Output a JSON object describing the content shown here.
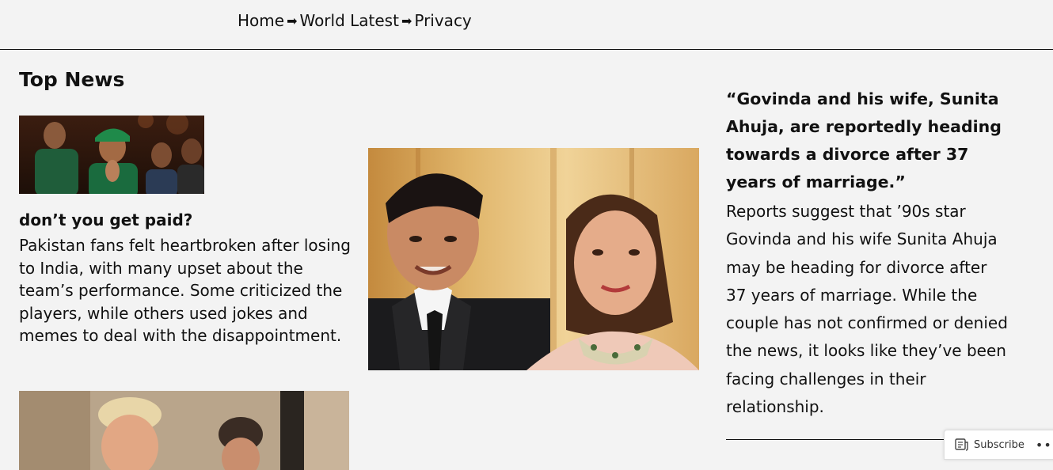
{
  "nav": {
    "items": [
      {
        "label": "Home"
      },
      {
        "label": "World Latest"
      },
      {
        "label": "Privacy"
      }
    ],
    "separator": "➡"
  },
  "main": {
    "section_title": "Top News",
    "articles": [
      {
        "title": "don’t you get paid?",
        "body": "Pakistan fans felt heartbroken after losing to India, with many upset about the team’s performance. Some criticized the players, while others used jokes and memes to deal with the disappointment."
      }
    ],
    "feature": {
      "quote": "“Govinda and his wife, Sunita Ahuja, are reportedly heading towards a divorce after 37 years of marriage.”",
      "body": "Reports suggest that ’90s star Govinda and his wife Sunita Ahuja may be heading for divorce after 37 years of marriage. While the couple has not confirmed or denied the news, it looks like they’ve been facing challenges in their relationship."
    }
  },
  "footer_bar": {
    "subscribe_label": "Subscribe",
    "more_label": "•••"
  },
  "icons": {
    "subscribe": "reader-icon"
  }
}
